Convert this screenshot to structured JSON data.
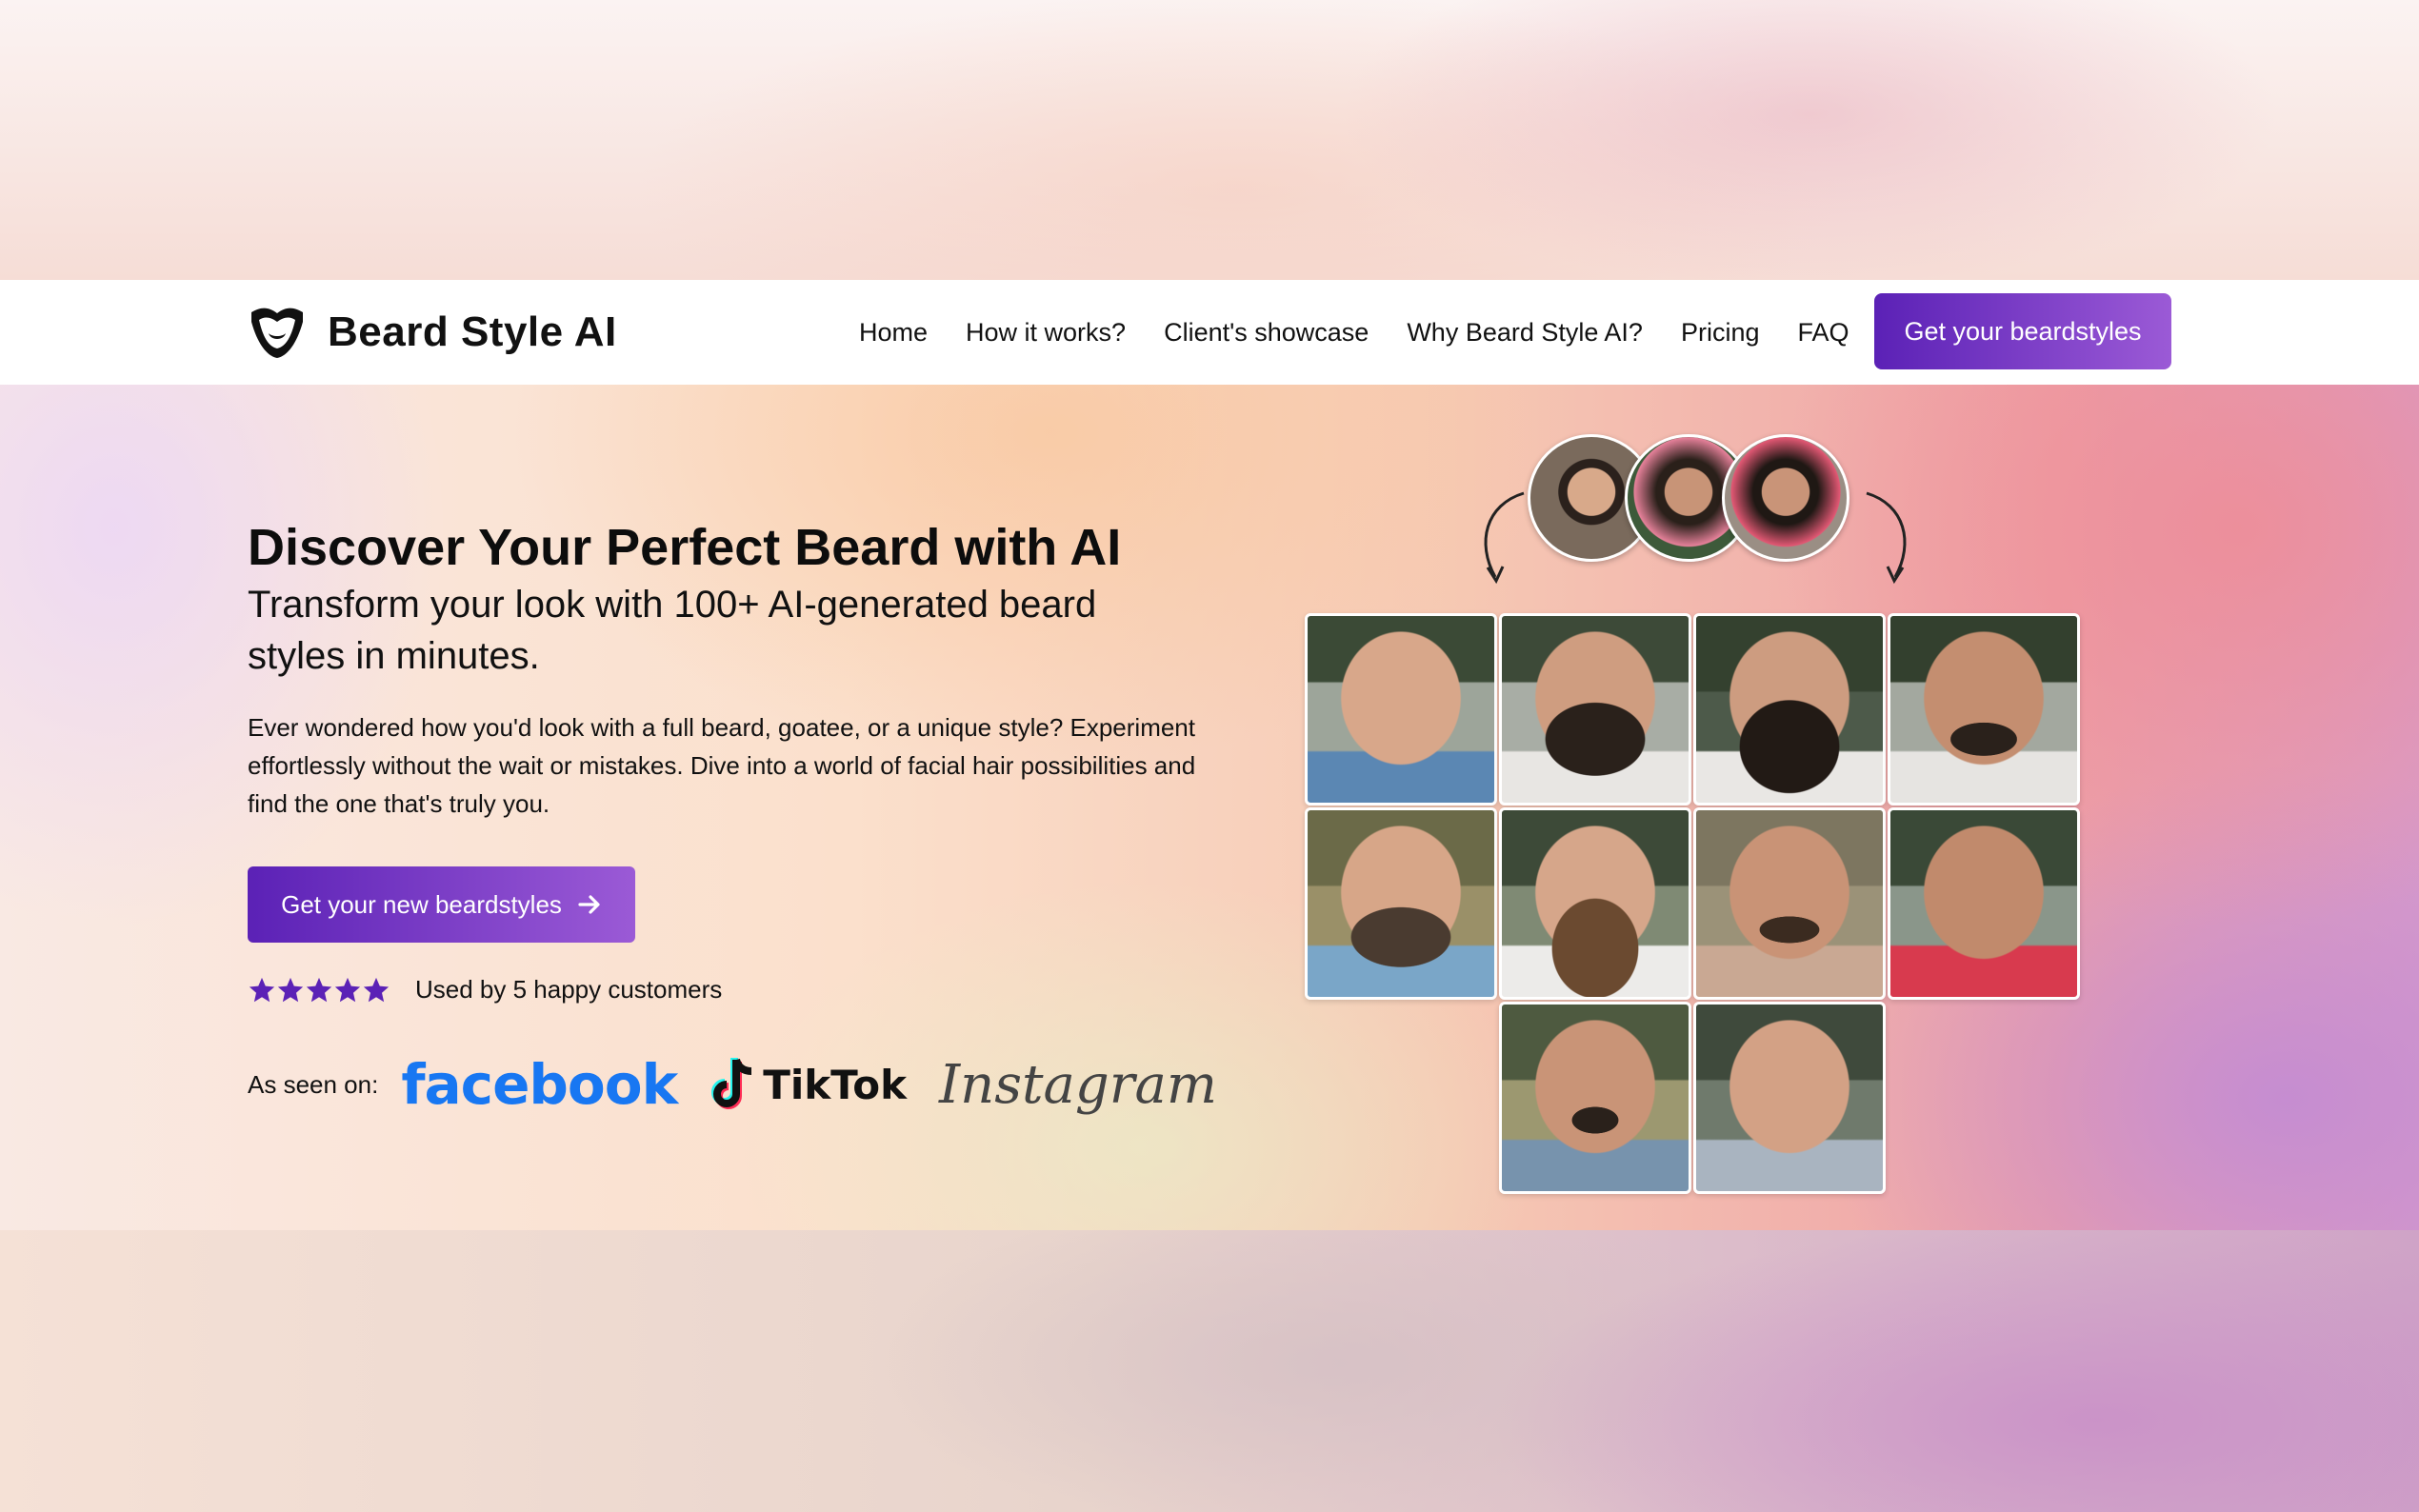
{
  "brand": {
    "name": "Beard Style AI",
    "logo_icon": "beard-mask-icon"
  },
  "nav": {
    "links": [
      "Home",
      "How it works?",
      "Client's showcase",
      "Why Beard Style AI?",
      "Pricing",
      "FAQ"
    ],
    "cta_label": "Get your beardstyles"
  },
  "hero": {
    "title": "Discover Your Perfect Beard with AI",
    "subtitle": "Transform your look with 100+ AI-generated beard styles in minutes.",
    "description": "Ever wondered how you'd look with a full beard, goatee, or a unique style? Experiment effortlessly without the wait or mistakes. Dive into a world of facial hair possibilities and find the one that's truly you.",
    "cta_label": "Get your new beardstyles",
    "cta_icon": "arrow-right-icon",
    "rating": {
      "stars": 5,
      "text": "Used by 5 happy customers"
    },
    "seen_on": {
      "label": "As seen on:",
      "logos": [
        "facebook",
        "TikTok",
        "Instagram"
      ]
    }
  },
  "colors": {
    "accent_start": "#5b21b6",
    "accent_end": "#9b5ad6",
    "star": "#5b21b6",
    "facebook": "#1877f2"
  }
}
